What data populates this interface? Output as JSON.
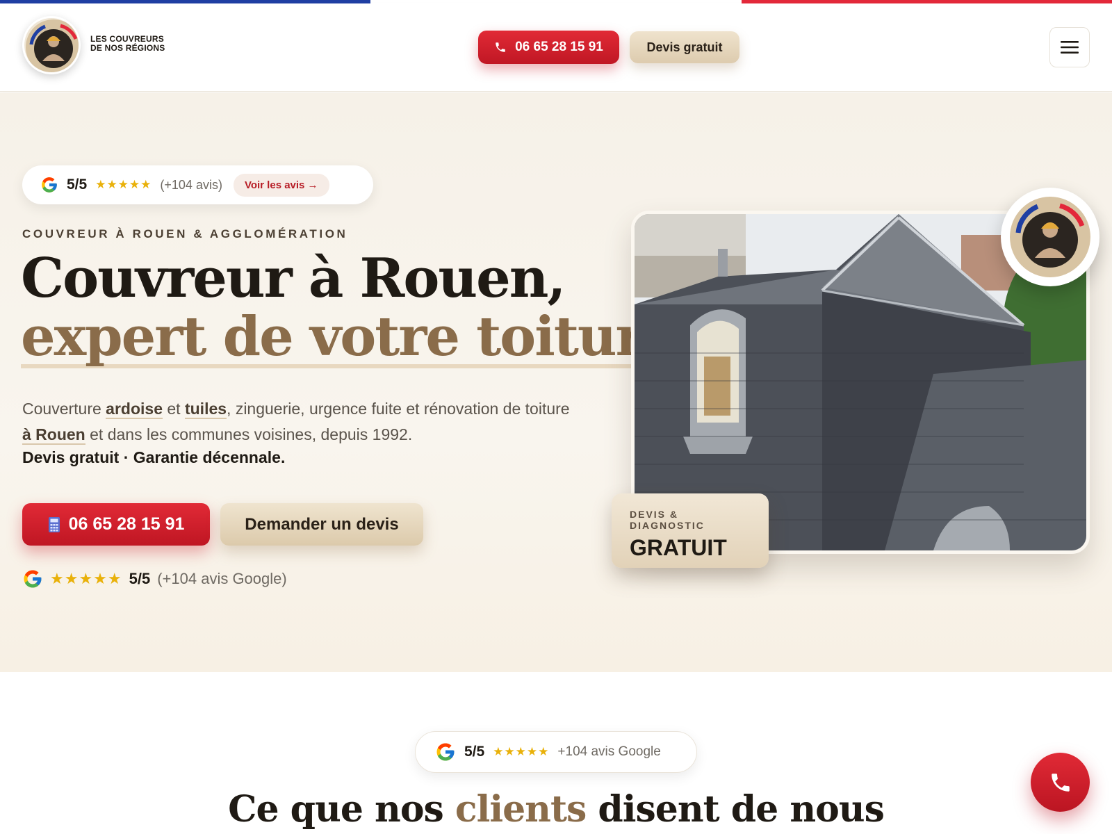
{
  "brand": {
    "line1": "LES COUVREURS",
    "line2": "DE NOS RÉGIONS"
  },
  "header": {
    "phone": "06 65 28 15 91",
    "devis": "Devis gratuit",
    "menu_icon": "hamburger-icon"
  },
  "hero": {
    "review_pill": {
      "score": "5/5",
      "stars": "★★★★★",
      "count": "(+104 avis)",
      "link": "Voir les avis →"
    },
    "eyebrow": "COUVREUR À ROUEN & AGGLOMÉRATION",
    "title_line1": "Couvreur à Rouen,",
    "title_line2": "expert de votre toiture",
    "lead": {
      "t1": "Couverture ",
      "ardoise": "ardoise",
      "t2": " et ",
      "tuiles": "tuiles",
      "t3": ", zinguerie, urgence fuite et rénovation de toiture ",
      "rouen": "à Rouen",
      "t4": " et dans les communes voisines, depuis 1992."
    },
    "lead_strong": "Devis gratuit · Garantie décennale.",
    "cta_phone": "06 65 28 15 91",
    "cta_phone_icon": "calculator-icon",
    "cta_devis": "Demander un devis",
    "rating": {
      "stars": "★★★★★",
      "score": "5/5",
      "count": "(+104 avis Google)"
    },
    "devis_card": {
      "kicker": "DEVIS & DIAGNOSTIC",
      "value": "GRATUIT"
    }
  },
  "reviews": {
    "badge": {
      "score": "5/5",
      "stars": "★★★★★",
      "count": "+104 avis Google"
    },
    "title_a": "Ce que nos ",
    "title_hl": "clients",
    "title_b": " disent de nous"
  },
  "colors": {
    "red": "#d21f2c",
    "beige": "#e6d6bd",
    "brown": "#8a6c4a",
    "dark": "#1f1a14",
    "star": "#e9b10a"
  }
}
